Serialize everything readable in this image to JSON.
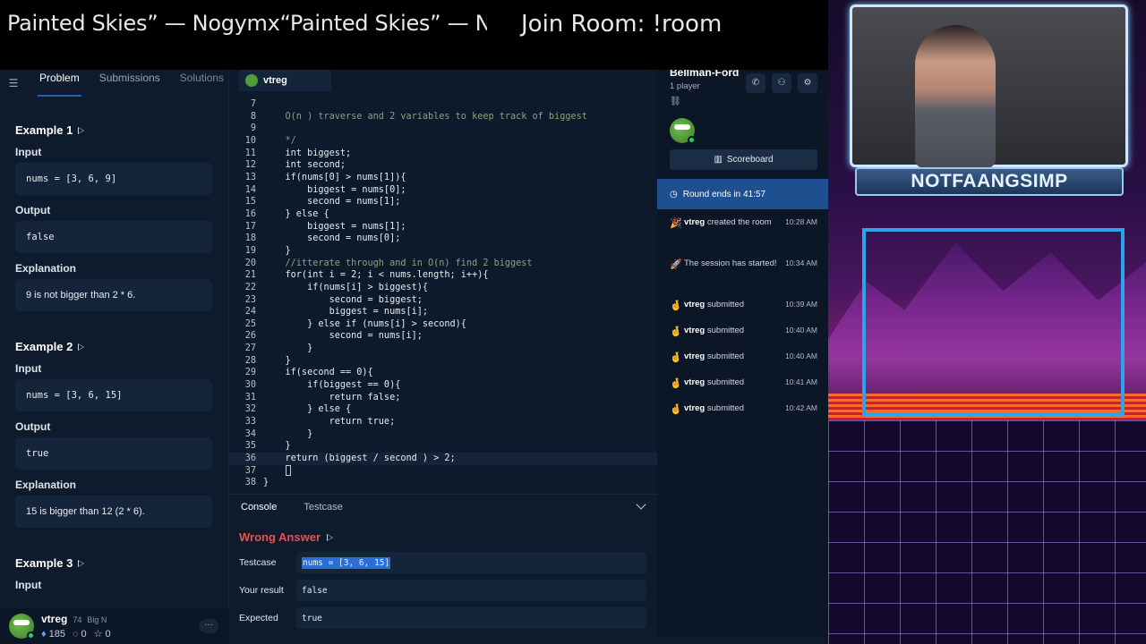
{
  "overlay": {
    "ticker": "Painted Skies” — Nogymx“Painted Skies” — Nogym",
    "join_room": "Join Room: !room"
  },
  "problem_tabs": [
    "Problem",
    "Submissions",
    "Solutions"
  ],
  "examples": [
    {
      "title": "Example 1",
      "input_label": "Input",
      "input": "nums = [3, 6, 9]",
      "output_label": "Output",
      "output": "false",
      "explanation_label": "Explanation",
      "explanation": "9 is not bigger than 2 * 6."
    },
    {
      "title": "Example 2",
      "input_label": "Input",
      "input": "nums = [3, 6, 15]",
      "output_label": "Output",
      "output": "true",
      "explanation_label": "Explanation",
      "explanation": "15 is bigger than 12 (2 * 6)."
    },
    {
      "title": "Example 3",
      "input_label": "Input"
    }
  ],
  "user": {
    "name": "vtreg",
    "level": "74",
    "rank": "Big N",
    "gems": "185",
    "streak": "0",
    "stars": "0"
  },
  "editor": {
    "tab_label": "vtreg",
    "lines": [
      {
        "n": "7",
        "t": ""
      },
      {
        "n": "8",
        "t": "    O(n ) traverse and 2 variables to keep track of biggest",
        "c": "cmt"
      },
      {
        "n": "9",
        "t": ""
      },
      {
        "n": "10",
        "t": "    */",
        "c": "cmt"
      },
      {
        "n": "11",
        "t": "    int biggest;"
      },
      {
        "n": "12",
        "t": "    int second;"
      },
      {
        "n": "13",
        "t": "    if(nums[0] > nums[1]){"
      },
      {
        "n": "14",
        "t": "        biggest = nums[0];"
      },
      {
        "n": "15",
        "t": "        second = nums[1];"
      },
      {
        "n": "16",
        "t": "    } else {"
      },
      {
        "n": "17",
        "t": "        biggest = nums[1];"
      },
      {
        "n": "18",
        "t": "        second = nums[0];"
      },
      {
        "n": "19",
        "t": "    }"
      },
      {
        "n": "20",
        "t": "    //itterate through and in O(n) find 2 biggest",
        "c": "cmt"
      },
      {
        "n": "21",
        "t": "    for(int i = 2; i < nums.length; i++){"
      },
      {
        "n": "22",
        "t": "        if(nums[i] > biggest){"
      },
      {
        "n": "23",
        "t": "            second = biggest;"
      },
      {
        "n": "24",
        "t": "            biggest = nums[i];"
      },
      {
        "n": "25",
        "t": "        } else if (nums[i] > second){"
      },
      {
        "n": "26",
        "t": "            second = nums[i];"
      },
      {
        "n": "27",
        "t": "        }"
      },
      {
        "n": "28",
        "t": "    }"
      },
      {
        "n": "29",
        "t": "    if(second == 0){"
      },
      {
        "n": "30",
        "t": "        if(biggest == 0){"
      },
      {
        "n": "31",
        "t": "            return false;"
      },
      {
        "n": "32",
        "t": "        } else {"
      },
      {
        "n": "33",
        "t": "            return true;"
      },
      {
        "n": "34",
        "t": "        }"
      },
      {
        "n": "35",
        "t": "    }"
      },
      {
        "n": "36",
        "t": "    return (biggest / second ) > 2;",
        "cur": true
      },
      {
        "n": "37",
        "t": ""
      },
      {
        "n": "38",
        "t": "}"
      }
    ]
  },
  "console": {
    "tabs": [
      "Console",
      "Testcase"
    ],
    "status": "Wrong Answer",
    "testcase_label": "Testcase",
    "testcase_value": "nums = [3, 6, 15]",
    "result_label": "Your result",
    "result_value": "false",
    "expected_label": "Expected",
    "expected_value": "true"
  },
  "room": {
    "title": "Bellman-Ford",
    "players": "1 player",
    "scoreboard": "Scoreboard",
    "round": "Round ends in 41:57",
    "feed": [
      {
        "icon": "🎉",
        "user": "vtreg",
        "msg": " created the room",
        "time": "10:28 AM"
      },
      {
        "icon": "🚀",
        "user": "",
        "msg": "The session has started!",
        "time": "10:34 AM"
      },
      {
        "icon": "🤞",
        "user": "vtreg",
        "msg": " submitted",
        "time": "10:39 AM"
      },
      {
        "icon": "🤞",
        "user": "vtreg",
        "msg": " submitted",
        "time": "10:40 AM"
      },
      {
        "icon": "🤞",
        "user": "vtreg",
        "msg": " submitted",
        "time": "10:40 AM"
      },
      {
        "icon": "🤞",
        "user": "vtreg",
        "msg": " submitted",
        "time": "10:41 AM"
      },
      {
        "icon": "🤞",
        "user": "vtreg",
        "msg": " submitted",
        "time": "10:42 AM"
      }
    ]
  },
  "stream": {
    "nameplate": "NOTFAANGSIMP"
  }
}
